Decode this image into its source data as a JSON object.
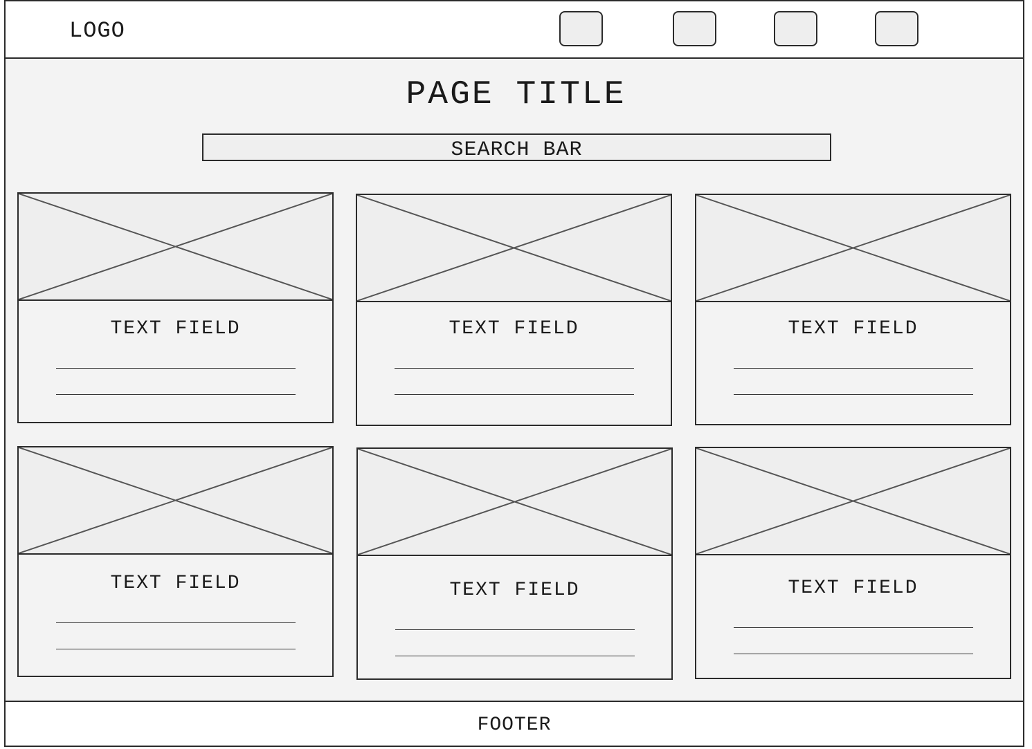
{
  "header": {
    "logo": "LOGO",
    "nav_buttons": [
      "",
      "",
      "",
      ""
    ]
  },
  "main": {
    "page_title": "PAGE TITLE",
    "search_bar": "SEARCH BAR",
    "cards": [
      {
        "text": "TEXT FIELD"
      },
      {
        "text": "TEXT FIELD"
      },
      {
        "text": "TEXT FIELD"
      },
      {
        "text": "TEXT FIELD"
      },
      {
        "text": "TEXT FIELD"
      },
      {
        "text": "TEXT FIELD"
      }
    ]
  },
  "footer": {
    "label": "FOOTER"
  },
  "colors": {
    "stroke": "#2b2b2b",
    "background": "#f3f3f3",
    "placeholder_fill": "#eeeeee"
  }
}
